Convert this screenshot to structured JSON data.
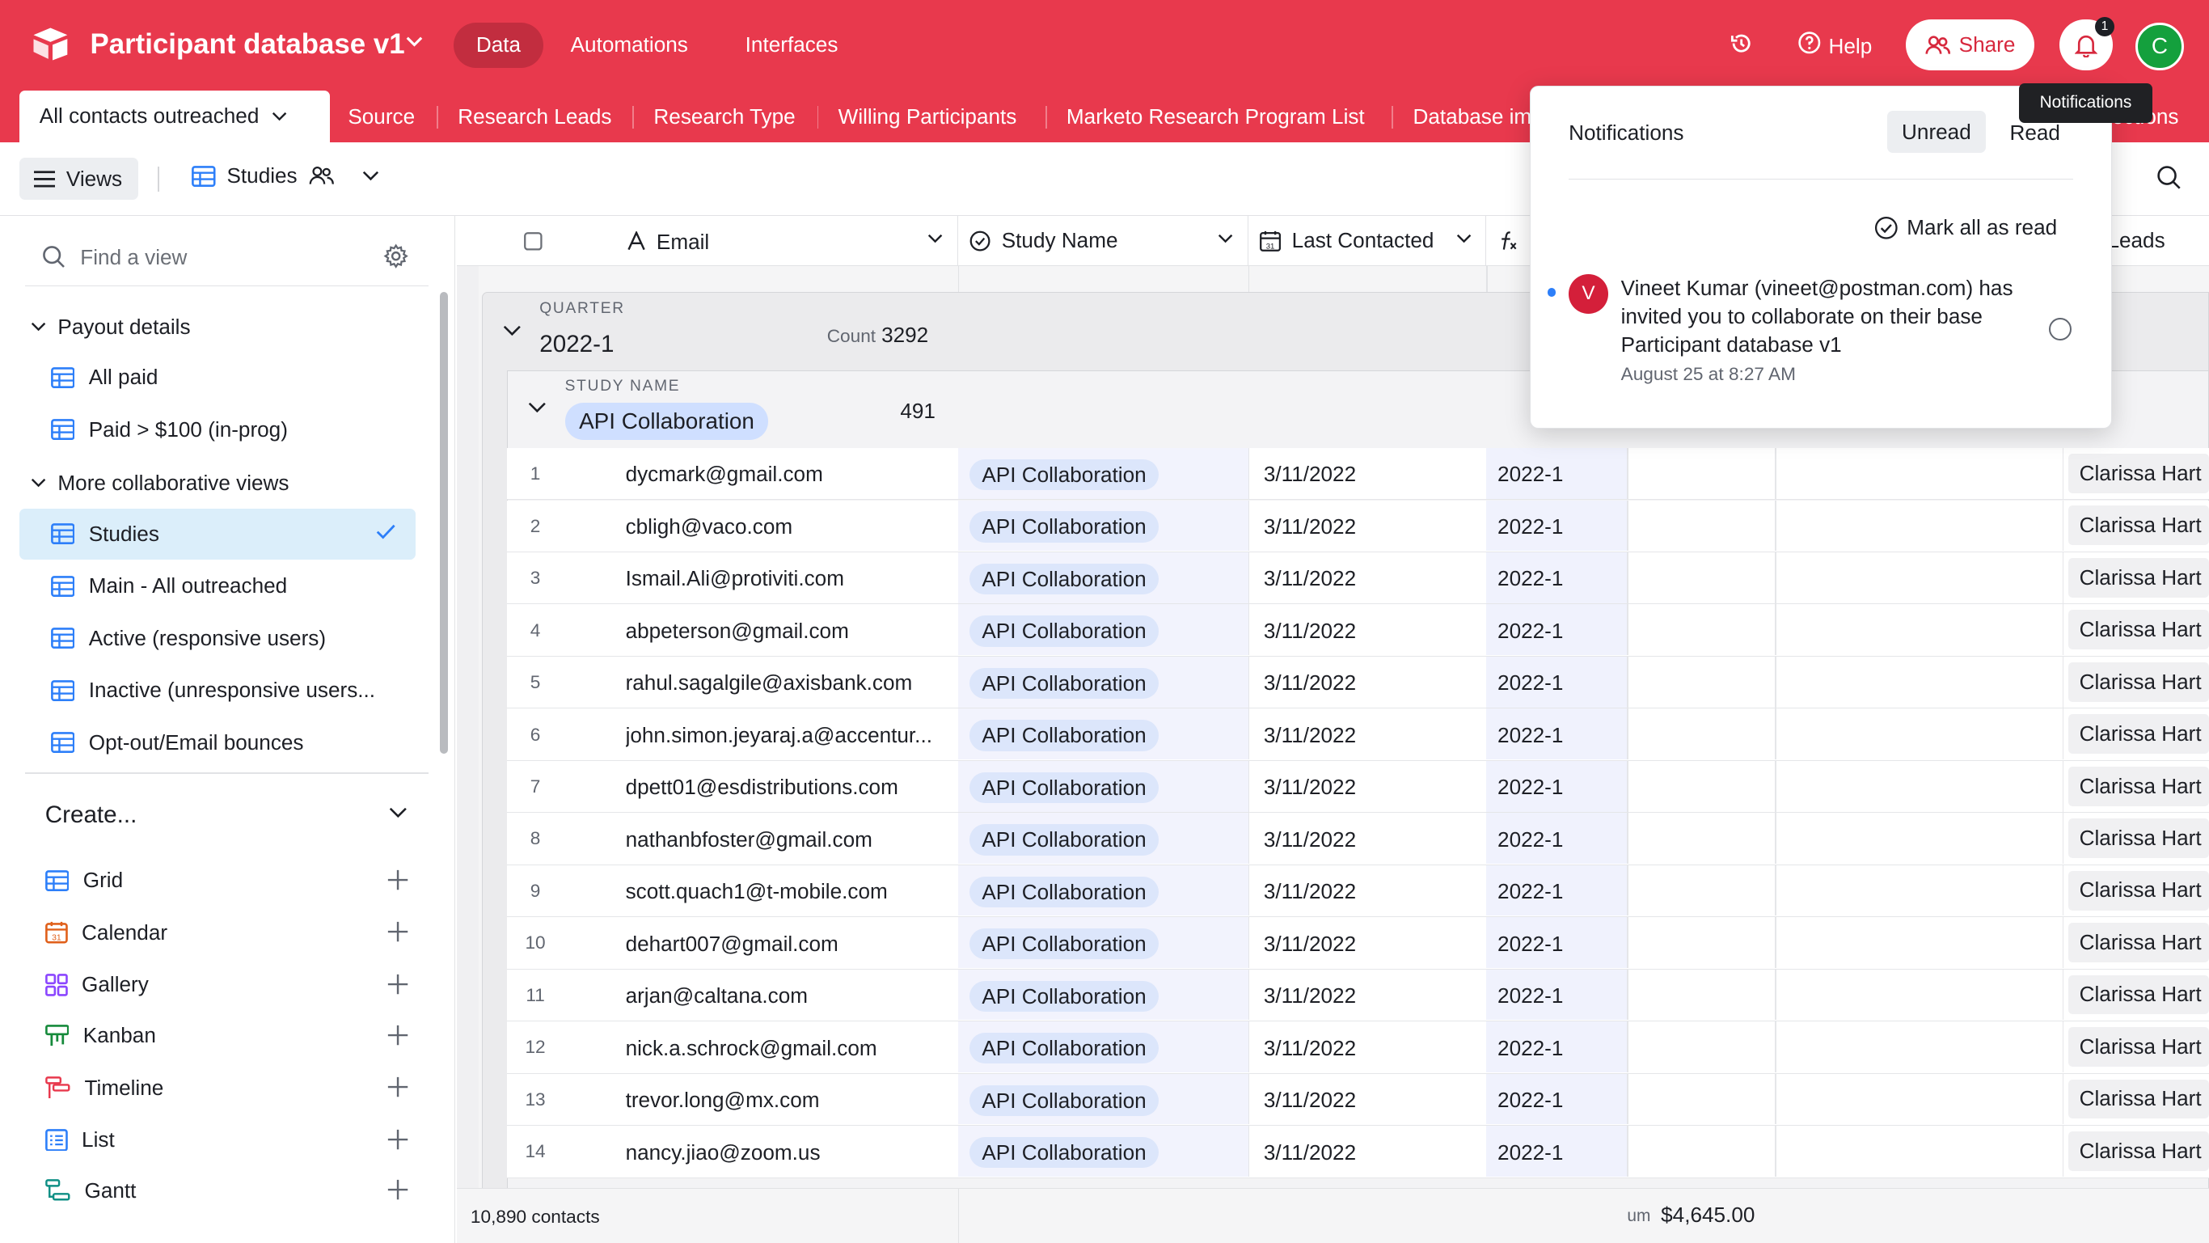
{
  "app": {
    "title": "Participant database v1",
    "nav": [
      "Data",
      "Automations",
      "Interfaces"
    ],
    "help": "Help",
    "share": "Share",
    "notification_count": "1",
    "avatar_initial": "C",
    "brand_color": "#e8394d"
  },
  "tabs": {
    "active": "All contacts outreached",
    "items": [
      "Source",
      "Research Leads",
      "Research Type",
      "Willing Participants",
      "Marketo Research Program List",
      "Database im"
    ],
    "peek": "ections"
  },
  "toolbar": {
    "views_label": "Views",
    "current_view": "Studies"
  },
  "sidebar": {
    "search_placeholder": "Find a view",
    "sections": [
      {
        "title": "Payout details",
        "items": [
          "All paid",
          "Paid > $100 (in-prog)"
        ]
      },
      {
        "title": "More collaborative views",
        "items": [
          "Studies",
          "Main - All outreached",
          "Active (responsive users)",
          "Inactive (unresponsive users...",
          "Opt-out/Email bounces"
        ]
      }
    ],
    "active_item": "Studies",
    "create_label": "Create...",
    "create_items": [
      {
        "label": "Grid",
        "icon": "grid-icon",
        "color": "#2d7ff9"
      },
      {
        "label": "Calendar",
        "icon": "calendar-icon",
        "color": "#e0601b"
      },
      {
        "label": "Gallery",
        "icon": "gallery-icon",
        "color": "#8b46ff"
      },
      {
        "label": "Kanban",
        "icon": "kanban-icon",
        "color": "#168a3b"
      },
      {
        "label": "Timeline",
        "icon": "timeline-icon",
        "color": "#e8394d"
      },
      {
        "label": "List",
        "icon": "list-icon",
        "color": "#2d7ff9"
      },
      {
        "label": "Gantt",
        "icon": "gantt-icon",
        "color": "#0e8f85"
      }
    ]
  },
  "grid": {
    "columns": [
      "Email",
      "Study Name",
      "Last Contacted",
      "Leads"
    ],
    "group1": {
      "label": "QUARTER",
      "value": "2022-1",
      "count_label": "Count",
      "count": "3292"
    },
    "group2": {
      "label": "STUDY NAME",
      "value": "API Collaboration",
      "count": "491"
    },
    "rows": [
      {
        "n": "1",
        "email": "dycmark@gmail.com",
        "study": "API Collaboration",
        "date": "3/11/2022",
        "quarter": "2022-1",
        "lead": "Clarissa Hart"
      },
      {
        "n": "2",
        "email": "cbligh@vaco.com",
        "study": "API Collaboration",
        "date": "3/11/2022",
        "quarter": "2022-1",
        "lead": "Clarissa Hart"
      },
      {
        "n": "3",
        "email": "Ismail.Ali@protiviti.com",
        "study": "API Collaboration",
        "date": "3/11/2022",
        "quarter": "2022-1",
        "lead": "Clarissa Hart"
      },
      {
        "n": "4",
        "email": "abpeterson@gmail.com",
        "study": "API Collaboration",
        "date": "3/11/2022",
        "quarter": "2022-1",
        "lead": "Clarissa Hart"
      },
      {
        "n": "5",
        "email": "rahul.sagalgile@axisbank.com",
        "study": "API Collaboration",
        "date": "3/11/2022",
        "quarter": "2022-1",
        "lead": "Clarissa Hart"
      },
      {
        "n": "6",
        "email": "john.simon.jeyaraj.a@accentur...",
        "study": "API Collaboration",
        "date": "3/11/2022",
        "quarter": "2022-1",
        "lead": "Clarissa Hart"
      },
      {
        "n": "7",
        "email": "dpett01@esdistributions.com",
        "study": "API Collaboration",
        "date": "3/11/2022",
        "quarter": "2022-1",
        "lead": "Clarissa Hart"
      },
      {
        "n": "8",
        "email": "nathanbfoster@gmail.com",
        "study": "API Collaboration",
        "date": "3/11/2022",
        "quarter": "2022-1",
        "lead": "Clarissa Hart"
      },
      {
        "n": "9",
        "email": "scott.quach1@t-mobile.com",
        "study": "API Collaboration",
        "date": "3/11/2022",
        "quarter": "2022-1",
        "lead": "Clarissa Hart"
      },
      {
        "n": "10",
        "email": "dehart007@gmail.com",
        "study": "API Collaboration",
        "date": "3/11/2022",
        "quarter": "2022-1",
        "lead": "Clarissa Hart"
      },
      {
        "n": "11",
        "email": "arjan@caltana.com",
        "study": "API Collaboration",
        "date": "3/11/2022",
        "quarter": "2022-1",
        "lead": "Clarissa Hart"
      },
      {
        "n": "12",
        "email": "nick.a.schrock@gmail.com",
        "study": "API Collaboration",
        "date": "3/11/2022",
        "quarter": "2022-1",
        "lead": "Clarissa Hart"
      },
      {
        "n": "13",
        "email": "trevor.long@mx.com",
        "study": "API Collaboration",
        "date": "3/11/2022",
        "quarter": "2022-1",
        "lead": "Clarissa Hart"
      },
      {
        "n": "14",
        "email": "nancy.jiao@zoom.us",
        "study": "API Collaboration",
        "date": "3/11/2022",
        "quarter": "2022-1",
        "lead": "Clarissa Hart"
      }
    ],
    "footer": {
      "count": "10,890 contacts",
      "sum_label": "um",
      "sum_value": "$4,645.00"
    }
  },
  "notifications": {
    "title": "Notifications",
    "unread": "Unread",
    "read": "Read",
    "mark_all": "Mark all as read",
    "avatar_initial": "V",
    "message": "Vineet Kumar (vineet@postman.com) has invited you to collaborate on their base Participant database v1",
    "time": "August 25 at 8:27 AM",
    "tooltip": "Notifications"
  }
}
